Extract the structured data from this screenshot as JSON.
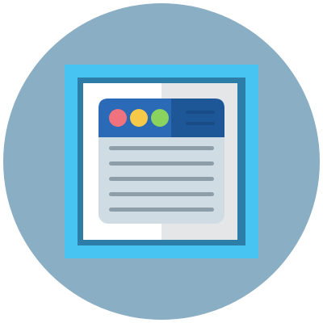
{
  "icon": {
    "name": "web-browser-window-icon",
    "colors": {
      "badge_circle": "#8AAFC4",
      "outer_frame": "#48C4F2",
      "inner_border": "#2C7DA8",
      "page_left": "#FFFFFF",
      "page_right": "#E4E6E8",
      "browser_body": "#CFDCE4",
      "text_lines": "#8E9EA9",
      "title_bar_left": "#2A6AB6",
      "title_bar_right": "#1E5797",
      "menu_lines": "#194C86",
      "dot_close": "#F0727E",
      "dot_minimize": "#F7C948",
      "dot_maximize": "#89D35E"
    },
    "content_line_count": 5,
    "menu_line_count": 2,
    "window_dot_count": 3
  }
}
